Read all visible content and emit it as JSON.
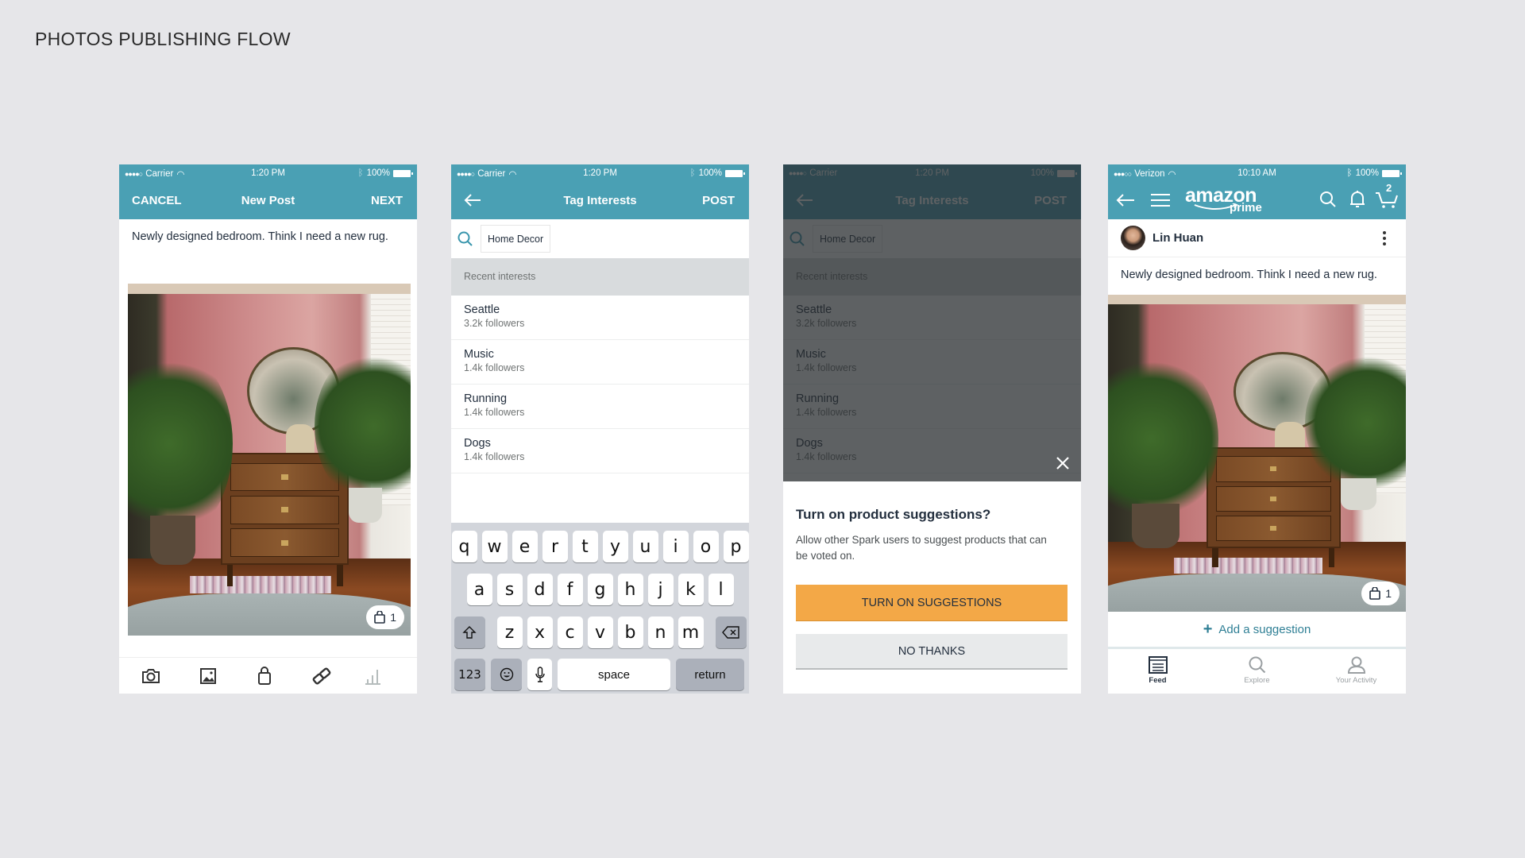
{
  "page_title": "PHOTOS PUBLISHING FLOW",
  "colors": {
    "header": "#4aa0b4",
    "primary_button": "#f3a847",
    "link": "#2f7f95",
    "background": "#e6e6e9"
  },
  "screen1": {
    "status": {
      "carrier": "Carrier",
      "time": "1:20 PM",
      "battery": "100%"
    },
    "nav": {
      "left": "CANCEL",
      "title": "New Post",
      "right": "NEXT"
    },
    "caption": "Newly designed bedroom. Think I need a new rug.",
    "photo_badge_count": "1",
    "toolbar_icons": [
      "camera-icon",
      "image-icon",
      "shopping-bag-icon",
      "link-icon",
      "bar-chart-icon"
    ]
  },
  "screen2": {
    "status": {
      "carrier": "Carrier",
      "time": "1:20 PM",
      "battery": "100%"
    },
    "nav": {
      "title": "Tag Interests",
      "right": "POST"
    },
    "search_value": "Home Decor",
    "section_header": "Recent interests",
    "interests": [
      {
        "name": "Seattle",
        "followers": "3.2k followers"
      },
      {
        "name": "Music",
        "followers": "1.4k followers"
      },
      {
        "name": "Running",
        "followers": "1.4k followers"
      },
      {
        "name": "Dogs",
        "followers": "1.4k followers"
      }
    ],
    "keyboard": {
      "row1": [
        "q",
        "w",
        "e",
        "r",
        "t",
        "y",
        "u",
        "i",
        "o",
        "p"
      ],
      "row2": [
        "a",
        "s",
        "d",
        "f",
        "g",
        "h",
        "j",
        "k",
        "l"
      ],
      "row3": [
        "z",
        "x",
        "c",
        "v",
        "b",
        "n",
        "m"
      ],
      "numbers": "123",
      "space": "space",
      "return": "return"
    }
  },
  "screen3": {
    "modal": {
      "title": "Turn on product suggestions?",
      "body": "Allow other Spark users to suggest products that can be voted on.",
      "primary": "TURN ON SUGGESTIONS",
      "secondary": "NO THANKS"
    }
  },
  "screen4": {
    "status": {
      "carrier": "Verizon",
      "time": "10:10 AM",
      "battery": "100%"
    },
    "logo": {
      "brand": "amazon",
      "sub": "prime"
    },
    "cart_count": "2",
    "user": "Lin Huan",
    "caption": "Newly designed bedroom. Think I need a new rug.",
    "photo_badge_count": "1",
    "add_suggestion": "Add a suggestion",
    "tabs": [
      {
        "label": "Feed",
        "icon": "feed-icon",
        "active": true
      },
      {
        "label": "Explore",
        "icon": "search-icon",
        "active": false
      },
      {
        "label": "Your Activity",
        "icon": "user-icon",
        "active": false
      }
    ]
  }
}
